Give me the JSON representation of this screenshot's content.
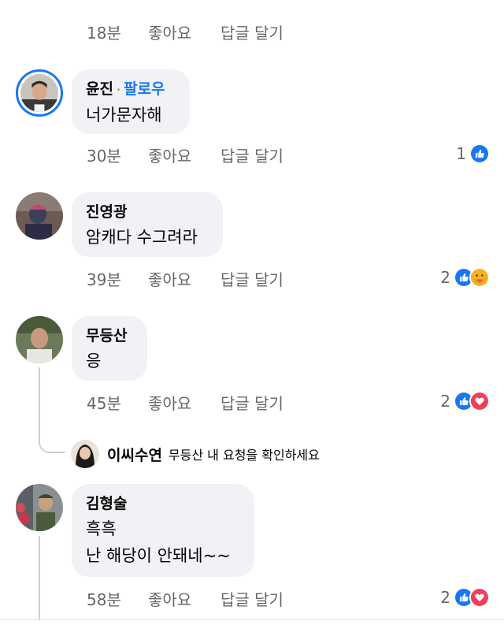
{
  "top_comment": {
    "time": "18분",
    "like_label": "좋아요",
    "reply_label": "답글 달기",
    "sticker_color": "#e53935"
  },
  "comments": [
    {
      "author": "윤진",
      "follow_label": "팔로우",
      "text_lines": [
        "너가문자해"
      ],
      "time": "30분",
      "like_label": "좋아요",
      "reply_label": "답글 달기",
      "reaction_count": "1",
      "reactions": [
        "like-icon"
      ]
    },
    {
      "author": "진영광",
      "text_lines": [
        "암캐다 수그려라"
      ],
      "time": "39분",
      "like_label": "좋아요",
      "reply_label": "답글 달기",
      "reaction_count": "2",
      "reactions": [
        "like-icon",
        "care-icon"
      ]
    },
    {
      "author": "무등산",
      "text_lines": [
        "응"
      ],
      "time": "45분",
      "like_label": "좋아요",
      "reply_label": "답글 달기",
      "reaction_count": "2",
      "reactions": [
        "like-icon",
        "love-icon"
      ]
    },
    {
      "author": "김형술",
      "text_lines": [
        "흑흑",
        "난 해당이 안돼네~~"
      ],
      "time": "58분",
      "like_label": "좋아요",
      "reply_label": "답글 달기",
      "reaction_count": "2",
      "reactions": [
        "like-icon",
        "love-icon"
      ]
    }
  ],
  "reply_summary": {
    "author": "이씨수연",
    "text": "무등산 내 요청을 확인하세요"
  },
  "colors": {
    "accent": "#1877f2",
    "bubble_bg": "#f0f2f5",
    "meta_text": "#65676b",
    "love": "#f33e58",
    "care": "#f7b125"
  }
}
